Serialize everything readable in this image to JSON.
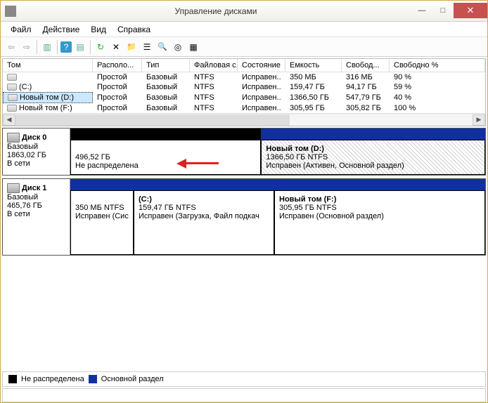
{
  "window": {
    "title": "Управление дисками",
    "minimize": "—",
    "maximize": "□",
    "close": "✕"
  },
  "menu": {
    "file": "Файл",
    "action": "Действие",
    "view": "Вид",
    "help": "Справка"
  },
  "toolbar_icons": {
    "back": "⇦",
    "forward": "⇨",
    "props": "▥",
    "help": "?",
    "list": "▤",
    "refresh": "↻",
    "delete": "✕",
    "folder": "📁",
    "tree": "☰",
    "find": "🔍",
    "scan": "◎",
    "map": "▦"
  },
  "cols": {
    "vol": "Том",
    "layout": "Располо...",
    "type": "Тип",
    "fs": "Файловая с...",
    "status": "Состояние",
    "cap": "Емкость",
    "free": "Свобод...",
    "freepct": "Свободно %"
  },
  "rows": [
    {
      "vol": "",
      "layout": "Простой",
      "type": "Базовый",
      "fs": "NTFS",
      "status": "Исправен..",
      "cap": "350 МБ",
      "free": "316 МБ",
      "freepct": "90 %"
    },
    {
      "vol": "(C:)",
      "layout": "Простой",
      "type": "Базовый",
      "fs": "NTFS",
      "status": "Исправен..",
      "cap": "159,47 ГБ",
      "free": "94,17 ГБ",
      "freepct": "59 %"
    },
    {
      "vol": "Новый том (D:)",
      "layout": "Простой",
      "type": "Базовый",
      "fs": "NTFS",
      "status": "Исправен..",
      "cap": "1366,50 ГБ",
      "free": "547,79 ГБ",
      "freepct": "40 %",
      "selected": true
    },
    {
      "vol": "Новый том (F:)",
      "layout": "Простой",
      "type": "Базовый",
      "fs": "NTFS",
      "status": "Исправен..",
      "cap": "305,95 ГБ",
      "free": "305,82 ГБ",
      "freepct": "100 %"
    }
  ],
  "disk0": {
    "name": "Диск 0",
    "type": "Базовый",
    "size": "1863,02 ГБ",
    "status": "В сети",
    "unalloc_size": "496,52 ГБ",
    "unalloc_label": "Не распределена",
    "part1_name": "Новый том  (D:)",
    "part1_size": "1366,50 ГБ NTFS",
    "part1_status": "Исправен (Активен, Основной раздел)"
  },
  "disk1": {
    "name": "Диск 1",
    "type": "Базовый",
    "size": "465,76 ГБ",
    "status": "В сети",
    "p1_size": "350 МБ NTFS",
    "p1_status": "Исправен (Сис",
    "p2_name": "(C:)",
    "p2_size": "159,47 ГБ NTFS",
    "p2_status": "Исправен (Загрузка, Файл подкач",
    "p3_name": "Новый том  (F:)",
    "p3_size": "305,95 ГБ NTFS",
    "p3_status": "Исправен (Основной раздел)"
  },
  "legend": {
    "unalloc": "Не распределена",
    "primary": "Основной раздел"
  }
}
